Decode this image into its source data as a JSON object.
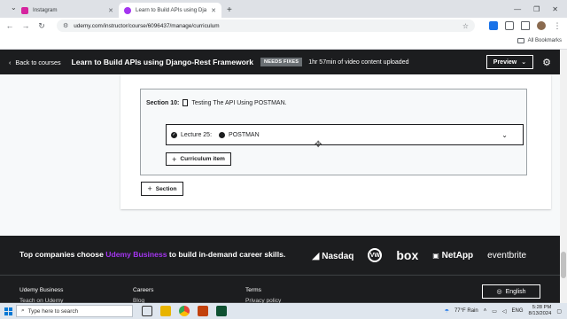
{
  "browser": {
    "tabs": [
      {
        "title": "Instagram",
        "favicon_color": "#d6249f",
        "active": false
      },
      {
        "title": "Learn to Build APIs using Djang",
        "favicon_color": "#a435f0",
        "active": true
      }
    ],
    "url": "udemy.com/instructor/course/6096437/manage/curriculum",
    "bookmarks_label": "All Bookmarks"
  },
  "header": {
    "back_label": "Back to courses",
    "course_title": "Learn to Build APIs using Django-Rest Framework",
    "badge": "NEEDS FIXES",
    "status": "1hr 57min of video content uploaded",
    "preview_label": "Preview"
  },
  "curriculum": {
    "section_label": "Section 10:",
    "section_title": "Testing The API Using POSTMAN.",
    "lecture_label": "Lecture 25:",
    "lecture_title": "POSTMAN",
    "curriculum_item_button": "Curriculum item",
    "section_button": "Section"
  },
  "footer": {
    "tagline_before": "Top companies choose ",
    "tagline_brand": "Udemy Business",
    "tagline_after": " to build in-demand career skills.",
    "logos": [
      "Nasdaq",
      "VW",
      "box",
      "NetApp",
      "eventbrite"
    ],
    "links_col1": [
      "Udemy Business",
      "Teach on Udemy"
    ],
    "links_col2": [
      "Careers",
      "Blog"
    ],
    "links_col3": [
      "Terms",
      "Privacy policy"
    ],
    "language": "English"
  },
  "taskbar": {
    "search_placeholder": "Type here to search",
    "weather": "77°F  Rain",
    "lang": "ENG",
    "time": "5:28 PM",
    "date": "8/13/2024"
  }
}
